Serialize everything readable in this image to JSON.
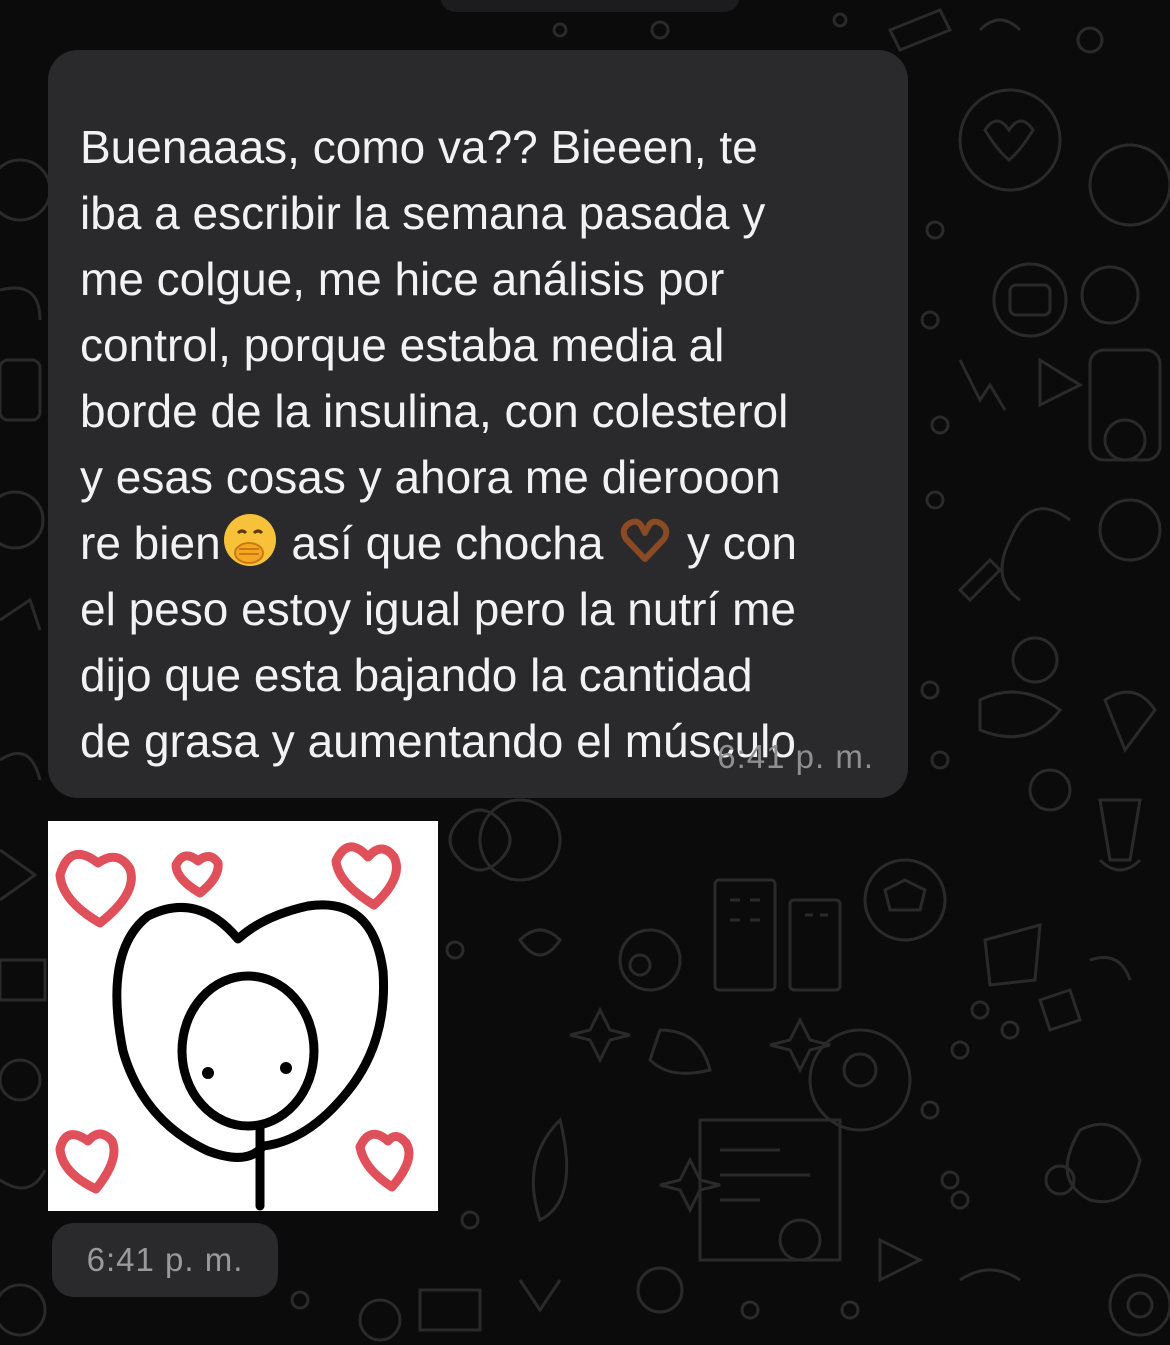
{
  "message": {
    "lines": [
      "Buenaaas, como va?? Bieeen, te",
      "iba a escribir la semana pasada y",
      "me colgue, me hice análisis por",
      "control, porque estaba media al",
      "borde de la insulina, con colesterol",
      "y esas cosas y ahora me dierooon",
      "re bien",
      " así que chocha ",
      " y con",
      "el peso estoy igual pero la nutrí me",
      "dijo que esta bajando la cantidad",
      "de grasa y aumentando el músculo"
    ],
    "time": "6:41 p. m.",
    "emojis": [
      "face-with-hand-over-mouth-icon",
      "heart-hands-icon"
    ]
  },
  "sticker": {
    "description_icon": "stick-figure-heart-sticker",
    "time": "6:41 p. m."
  },
  "colors": {
    "background": "#0b0b0b",
    "bubble": "#2a2a2c",
    "text": "#f2f2f2",
    "timestamp": "#8e8e93",
    "heart": "#e0505a"
  }
}
